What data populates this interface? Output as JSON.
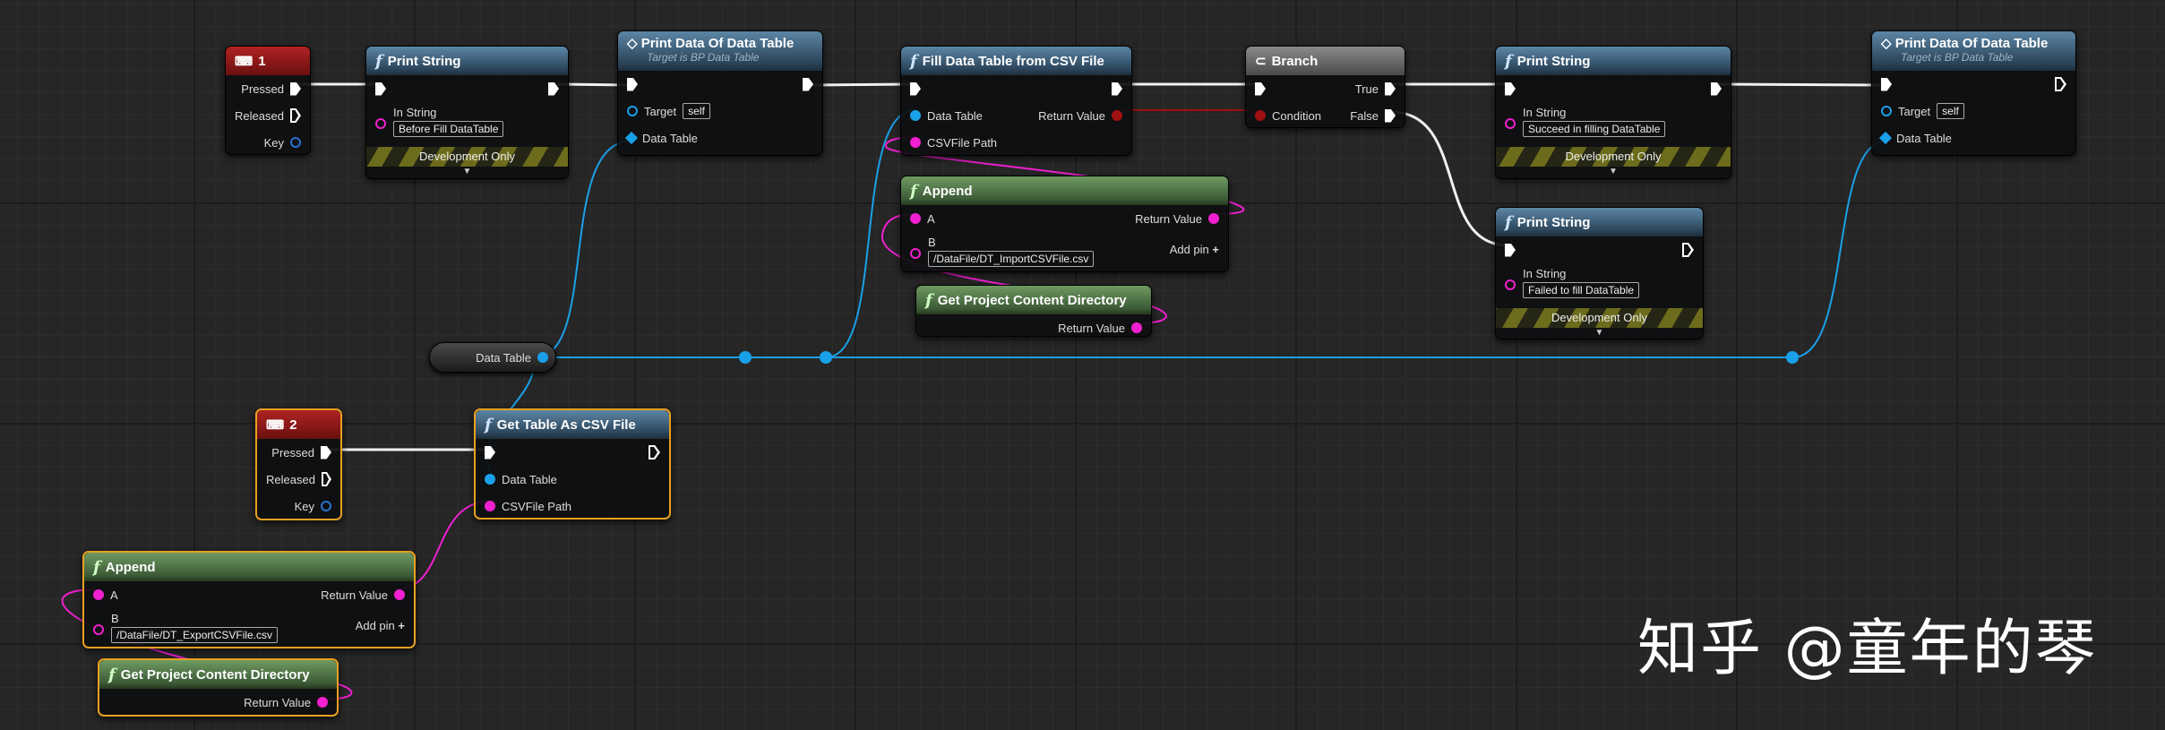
{
  "nodes": {
    "key1": {
      "title": "1",
      "pressed": "Pressed",
      "released": "Released",
      "key": "Key"
    },
    "print1": {
      "title": "Print String",
      "in_string": "In String",
      "value": "Before Fill DataTable",
      "dev": "Development Only"
    },
    "printdata1": {
      "title": "Print Data Of Data Table",
      "subtitle": "Target is BP Data Table",
      "target": "Target",
      "self": "self",
      "data_table": "Data Table"
    },
    "fill": {
      "title": "Fill Data Table from CSV File",
      "data_table": "Data Table",
      "return_value": "Return Value",
      "csv_path": "CSVFile Path"
    },
    "branch": {
      "title": "Branch",
      "true": "True",
      "false": "False",
      "condition": "Condition"
    },
    "print2": {
      "title": "Print String",
      "in_string": "In String",
      "value": "Succeed in filling DataTable",
      "dev": "Development Only"
    },
    "printdata2": {
      "title": "Print Data Of Data Table",
      "subtitle": "Target is BP Data Table",
      "target": "Target",
      "self": "self",
      "data_table": "Data Table"
    },
    "append1": {
      "title": "Append",
      "a": "A",
      "b": "B",
      "b_value": "/DataFile/DT_ImportCSVFile.csv",
      "return_value": "Return Value",
      "add_pin": "Add pin"
    },
    "getdir1": {
      "title": "Get Project Content Directory",
      "return_value": "Return Value"
    },
    "print3": {
      "title": "Print String",
      "in_string": "In String",
      "value": "Failed to fill DataTable",
      "dev": "Development Only"
    },
    "var": {
      "label": "Data Table"
    },
    "key2": {
      "title": "2",
      "pressed": "Pressed",
      "released": "Released",
      "key": "Key"
    },
    "gettable": {
      "title": "Get Table As CSV File",
      "data_table": "Data Table",
      "csv_path": "CSVFile Path"
    },
    "append2": {
      "title": "Append",
      "a": "A",
      "b": "B",
      "b_value": "/DataFile/DT_ExportCSVFile.csv",
      "return_value": "Return Value",
      "add_pin": "Add pin"
    },
    "getdir2": {
      "title": "Get Project Content Directory",
      "return_value": "Return Value"
    }
  },
  "watermark": "知乎 @童年的琴",
  "colors": {
    "exec": "#ffffff",
    "string": "#f020d0",
    "object": "#1aa0e8",
    "bool": "#a01010",
    "selected": "#e8a020"
  }
}
